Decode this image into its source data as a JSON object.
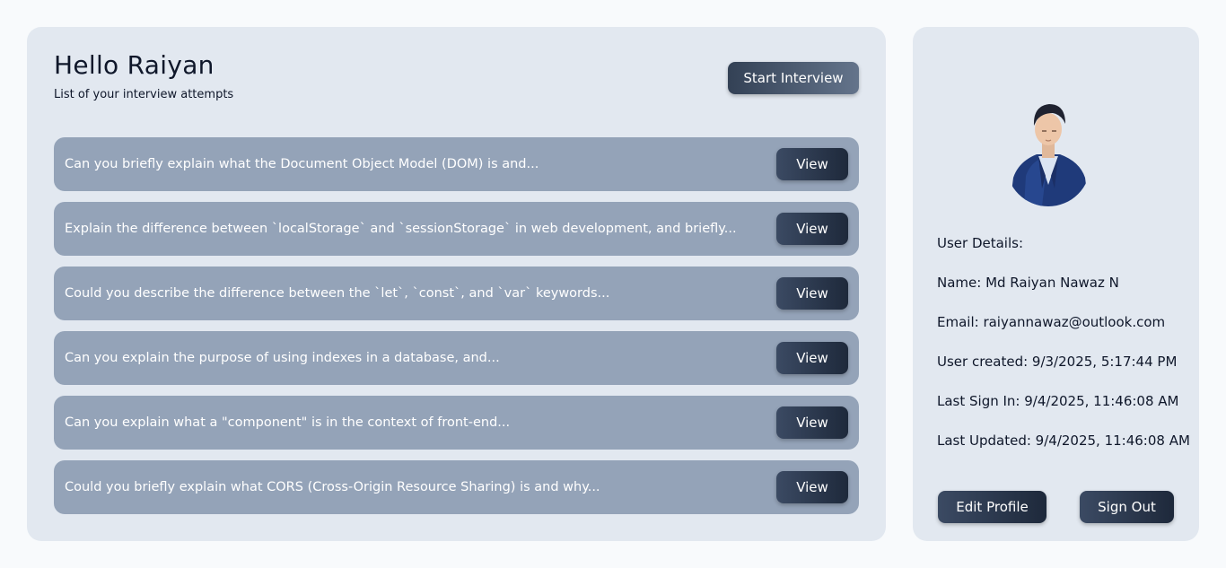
{
  "header": {
    "greeting": "Hello Raiyan",
    "subtitle": "List of your interview attempts",
    "start_label": "Start Interview"
  },
  "attempts": [
    {
      "question": "Can you briefly explain what the Document Object Model (DOM) is and...",
      "action": "View"
    },
    {
      "question": "Explain the difference between `localStorage` and `sessionStorage` in web development, and briefly...",
      "action": "View"
    },
    {
      "question": "Could you describe the difference between the `let`, `const`, and `var` keywords...",
      "action": "View"
    },
    {
      "question": "Can you explain the purpose of using indexes in a database, and...",
      "action": "View"
    },
    {
      "question": "Can you explain what a \"component\" is in the context of front-end...",
      "action": "View"
    },
    {
      "question": "Could you briefly explain what CORS (Cross-Origin Resource Sharing) is and why...",
      "action": "View"
    }
  ],
  "user": {
    "details_heading": "User Details:",
    "name": "Name: Md Raiyan Nawaz N",
    "email": "Email: raiyannawaz@outlook.com",
    "created": "User created: 9/3/2025, 5:17:44 PM",
    "last_sign_in": "Last Sign In: 9/4/2025, 11:46:08 AM",
    "last_updated": "Last Updated: 9/4/2025, 11:46:08 AM",
    "edit_label": "Edit Profile",
    "signout_label": "Sign Out"
  },
  "colors": {
    "panel": "#e2e8f0",
    "attempt_row": "#94a3b8",
    "button_dark": "#1e293b"
  }
}
